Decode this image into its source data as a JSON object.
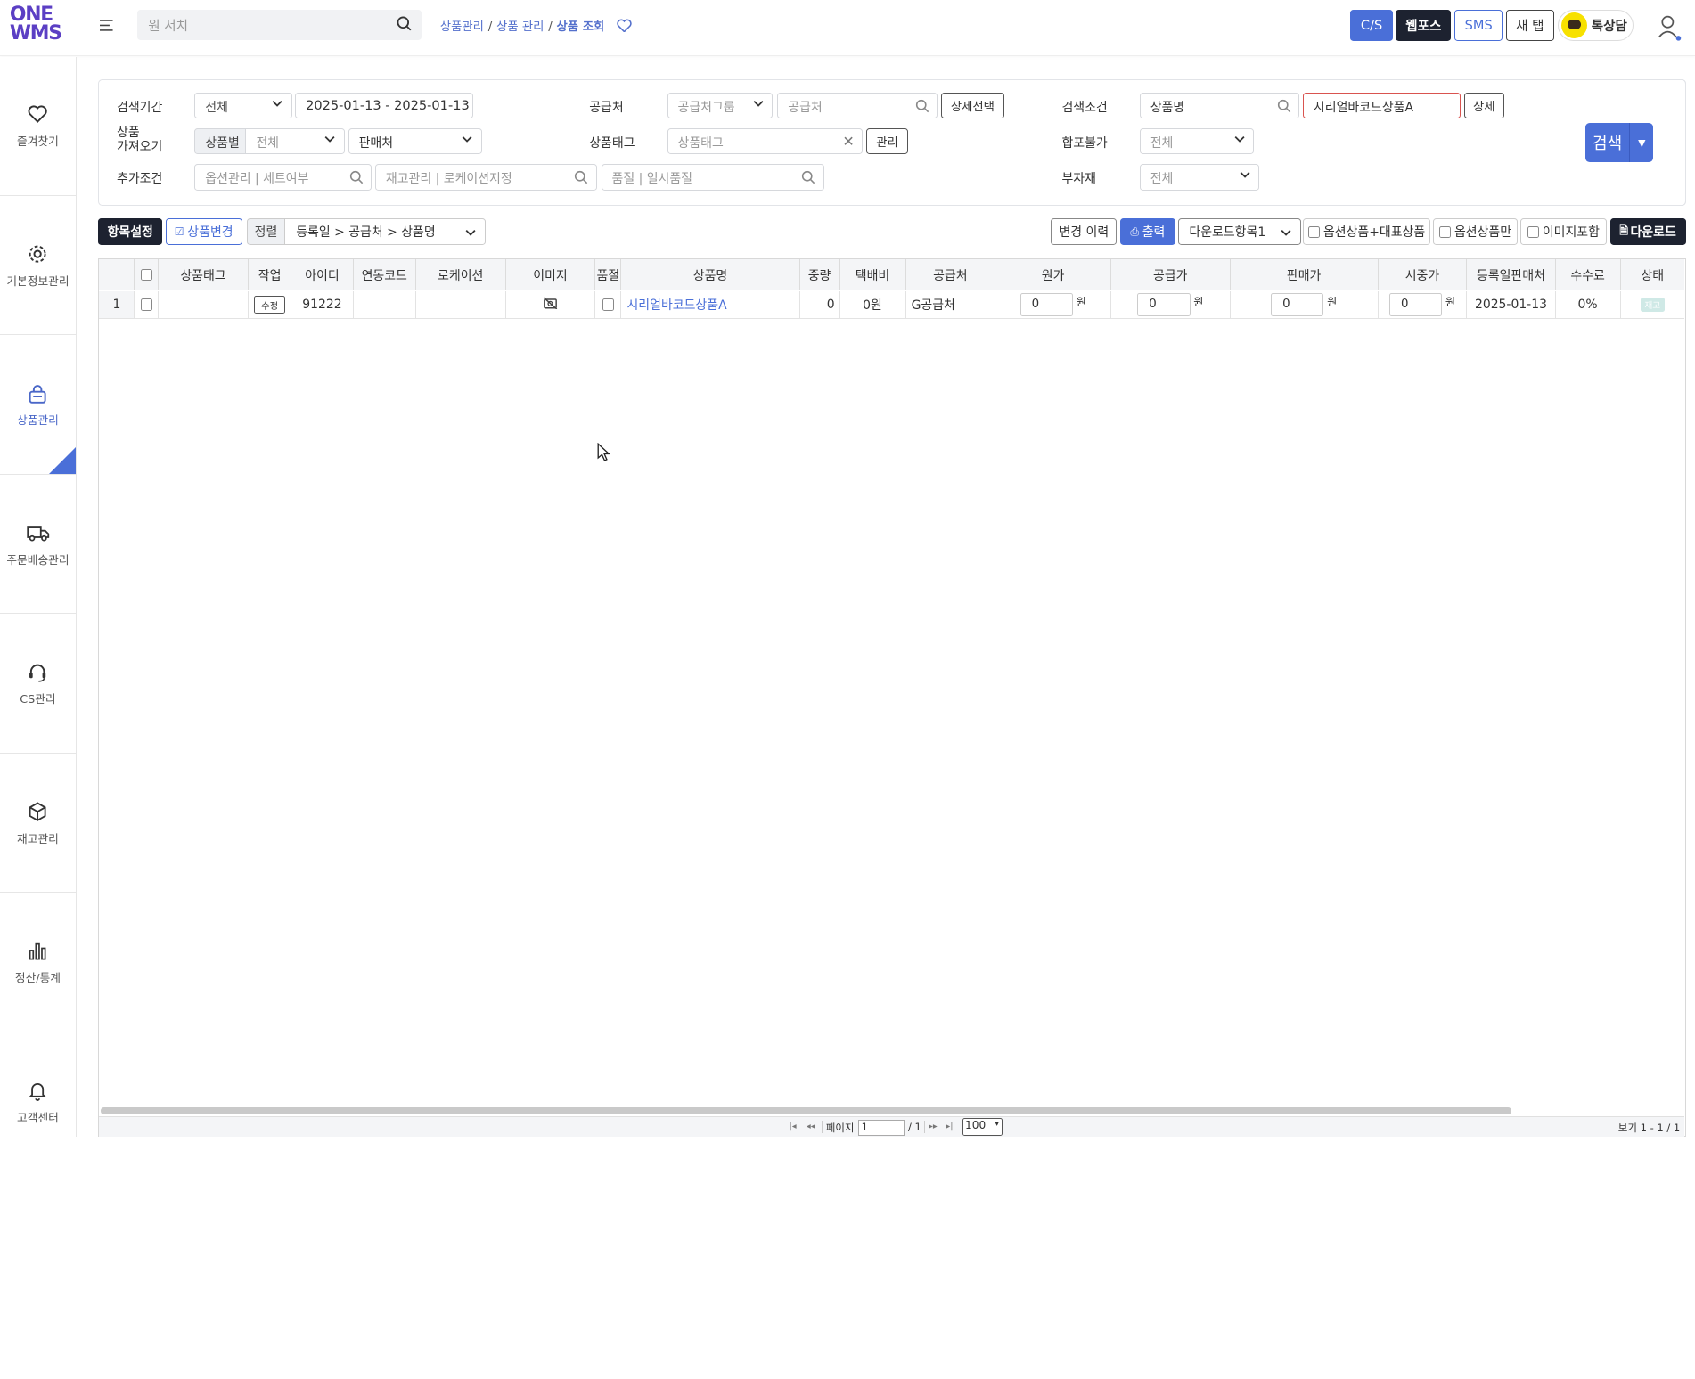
{
  "app": {
    "logo_top": "ONE",
    "logo_bottom": "WMS"
  },
  "global_search": {
    "placeholder": "원 서치"
  },
  "breadcrumb": {
    "items": [
      "상품관리",
      "상품 관리",
      "상품 조회"
    ]
  },
  "topbar_buttons": {
    "cs": "C/S",
    "webpos": "웹포스",
    "sms": "SMS",
    "newtab": "새 탭",
    "talk": "톡상담"
  },
  "sidebar": {
    "items": [
      {
        "label": "즐겨찾기"
      },
      {
        "label": "기본정보관리"
      },
      {
        "label": "상품관리"
      },
      {
        "label": "주문배송관리"
      },
      {
        "label": "CS관리"
      },
      {
        "label": "재고관리"
      },
      {
        "label": "정산/통계"
      },
      {
        "label": "고객센터"
      }
    ]
  },
  "filters": {
    "period_label": "검색기간",
    "period_select": "전체",
    "date_range": "2025-01-13 - 2025-01-13",
    "import_label_1": "상품",
    "import_label_2": "가져오기",
    "import_tag": "상품별",
    "import_select": "전체",
    "import_seller": "판매처",
    "extra_label": "추가조건",
    "extra_1": "옵션관리 | 세트여부",
    "extra_2": "재고관리 | 로케이션지정",
    "extra_3": "품절 | 일시품절",
    "supplier_label": "공급처",
    "supplier_group": "공급처그룹",
    "supplier_input": "공급처",
    "supplier_detail": "상세선택",
    "tag_label": "상품태그",
    "tag_input": "상품태그",
    "tag_manage": "관리",
    "cond_label": "검색조건",
    "cond_field": "상품명",
    "cond_value": "시리얼바코드상품A",
    "cond_detail": "상세",
    "bundle_label": "합포불가",
    "bundle_select": "전체",
    "sub_label": "부자재",
    "sub_select": "전체",
    "search_button": "검색"
  },
  "toolbar": {
    "columns": "항목설정",
    "change": "상품변경",
    "sort": "정렬",
    "sort_value": "등록일 > 공급처 > 상품명",
    "history": "변경 이력",
    "print": "출력",
    "download_select": "다운로드항목1",
    "opt_rep": "옵션상품+대표상품",
    "opt_only": "옵션상품만",
    "img_incl": "이미지포함",
    "download": "다운로드"
  },
  "table": {
    "headers": [
      "상품태그",
      "작업",
      "아이디",
      "연동코드",
      "로케이션",
      "이미지",
      "품절",
      "상품명",
      "중량",
      "택배비",
      "공급처",
      "원가",
      "공급가",
      "판매가",
      "시중가",
      "등록일판매처",
      "수수료",
      "상태"
    ],
    "rows": [
      {
        "num": "1",
        "tag": "",
        "action": "수정",
        "id": "91222",
        "link_code": "",
        "location": "",
        "soldout": "",
        "name": "시리얼바코드상품A",
        "weight": "0",
        "ship": "0원",
        "supplier": "G공급처",
        "cost": "0",
        "supply": "0",
        "sale": "0",
        "market": "0",
        "won": "원",
        "reg": "2025-01-13",
        "fee": "0%",
        "status": "재고"
      }
    ]
  },
  "pager": {
    "page_label": "페이지",
    "page_value": "1",
    "total": "/ 1",
    "size": "100",
    "view": "보기 1 - 1 / 1"
  },
  "colors": {
    "accent": "#4a6fd8",
    "brand": "#5b3fc4",
    "dark": "#1d2230"
  }
}
